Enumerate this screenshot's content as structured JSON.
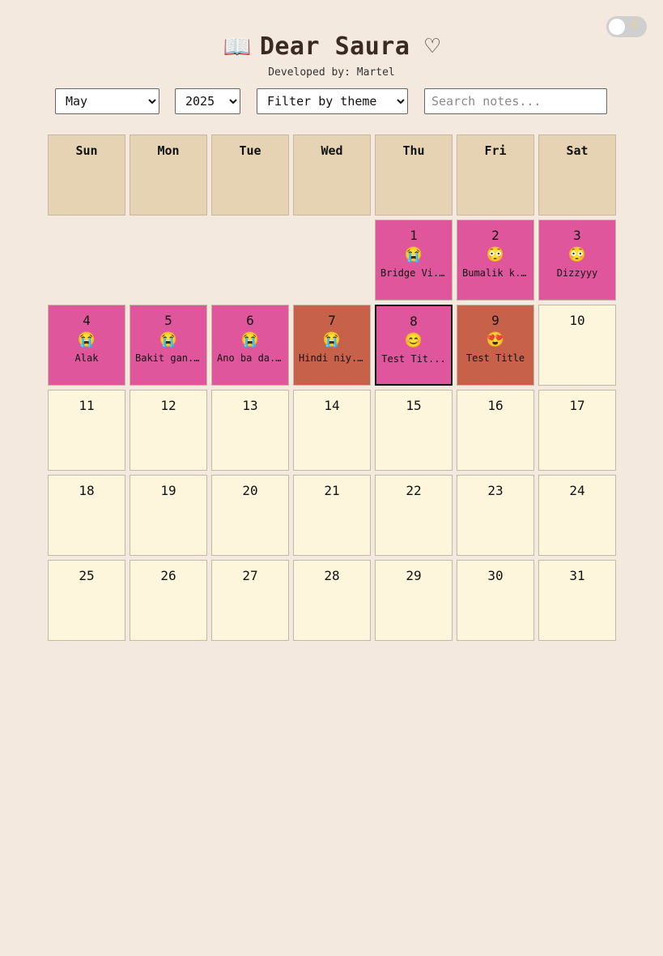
{
  "header": {
    "icon": "📖",
    "title": "Dear Saura ♡",
    "subtitle": "Developed by: Martel"
  },
  "toggle": {
    "icon": "moon-icon",
    "state": "off"
  },
  "controls": {
    "month": {
      "selected": "May"
    },
    "year": {
      "selected": "2025"
    },
    "theme": {
      "selected": "Filter by theme"
    },
    "search": {
      "placeholder": "Search notes...",
      "value": ""
    }
  },
  "weekdays": [
    "Sun",
    "Mon",
    "Tue",
    "Wed",
    "Thu",
    "Fri",
    "Sat"
  ],
  "colors": {
    "pink": "#e0569c",
    "red": "#c8614a",
    "empty_day": "#fdf6dc",
    "header_cell": "#e5d3b3",
    "background": "#f3e9de"
  },
  "days": [
    {
      "n": "1",
      "emoji": "😭",
      "title": "Bridge Vi..."
    },
    {
      "n": "2",
      "emoji": "😳",
      "title": "Bumalik k..."
    },
    {
      "n": "3",
      "emoji": "😳",
      "title": "Dizzyyy"
    },
    {
      "n": "4",
      "emoji": "😭",
      "title": "Alak"
    },
    {
      "n": "5",
      "emoji": "😭",
      "title": "Bakit gan..."
    },
    {
      "n": "6",
      "emoji": "😭",
      "title": "Ano ba da..."
    },
    {
      "n": "7",
      "emoji": "😭",
      "title": "Hindi niy..."
    },
    {
      "n": "8",
      "emoji": "😊",
      "title": "Test Tit..."
    },
    {
      "n": "9",
      "emoji": "😍",
      "title": "Test Title"
    },
    {
      "n": "10"
    },
    {
      "n": "11"
    },
    {
      "n": "12"
    },
    {
      "n": "13"
    },
    {
      "n": "14"
    },
    {
      "n": "15"
    },
    {
      "n": "16"
    },
    {
      "n": "17"
    },
    {
      "n": "18"
    },
    {
      "n": "19"
    },
    {
      "n": "20"
    },
    {
      "n": "21"
    },
    {
      "n": "22"
    },
    {
      "n": "23"
    },
    {
      "n": "24"
    },
    {
      "n": "25"
    },
    {
      "n": "26"
    },
    {
      "n": "27"
    },
    {
      "n": "28"
    },
    {
      "n": "29"
    },
    {
      "n": "30"
    },
    {
      "n": "31"
    }
  ]
}
